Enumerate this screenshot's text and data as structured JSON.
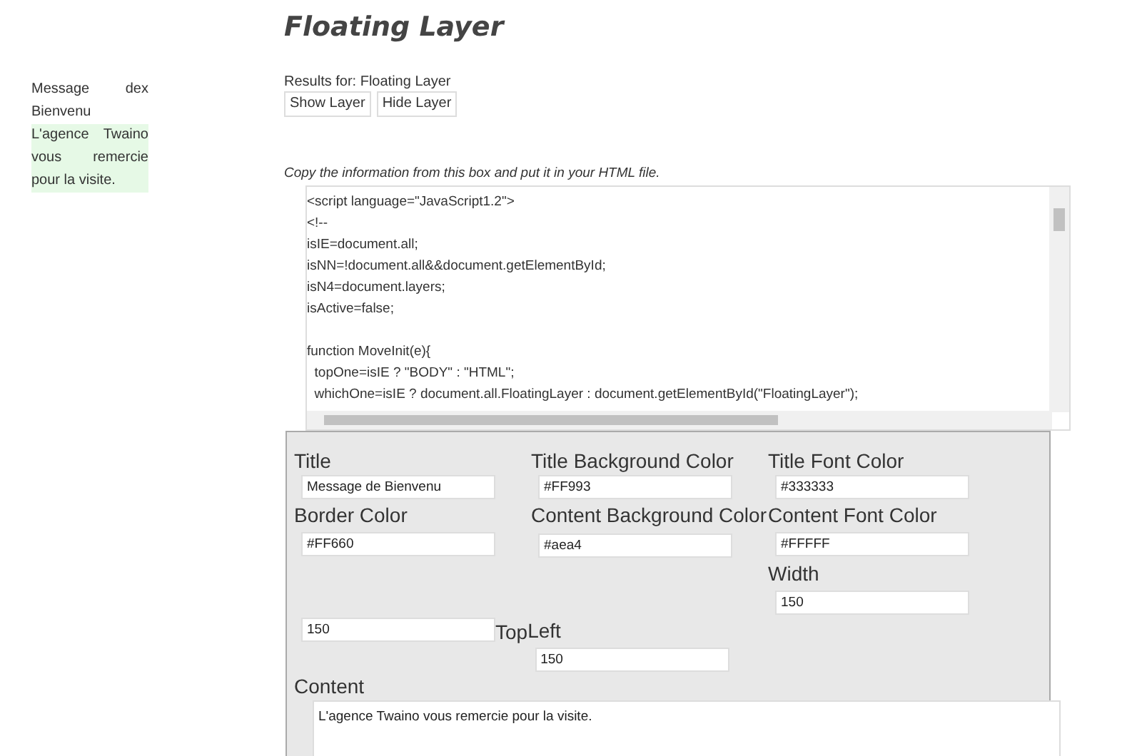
{
  "floating_layer": {
    "title": "Message de Bienvenu",
    "close": "x",
    "content": "L'agence Twaino vous remercie pour la visite."
  },
  "heading": "Floating Layer",
  "results": "Results for: Floating Layer",
  "buttons": [
    "Show Layer",
    "Hide Layer"
  ],
  "instructions": "Copy the information from this box and put it in your HTML file.",
  "code_blocks": [
    [
      "<script language=\"JavaScript1.2\">",
      "<!--",
      "isIE=document.all;",
      "isNN=!document.all&&document.getElementById;",
      "isN4=document.layers;",
      "isActive=false;"
    ],
    [
      "function MoveInit(e){",
      "  topOne=isIE ? \"BODY\" : \"HTML\";",
      "  whichOne=isIE ? document.all.FloatingLayer : document.getElementById(\"FloatingLayer\");"
    ]
  ],
  "form": {
    "title": {
      "label": "Title",
      "value": "Message de Bienvenu"
    },
    "title_background": {
      "label": "Title Background Color",
      "value": "#FF993"
    },
    "title_font": {
      "label": "Title Font Color",
      "value": "#333333"
    },
    "border": {
      "label": "Border Color",
      "value": "#FF660"
    },
    "content_background": {
      "label": "Content Background Color",
      "value": "#aea4"
    },
    "content_font": {
      "label": "Content Font Color",
      "value": "#FFFFF"
    },
    "width": {
      "label": "Width",
      "value": "150"
    },
    "top": {
      "label": "Top",
      "value": "150"
    },
    "left": {
      "label": "Left",
      "value": "150"
    },
    "content": {
      "label": "Content",
      "value": "L'agence Twaino vous remercie pour la visite."
    }
  }
}
